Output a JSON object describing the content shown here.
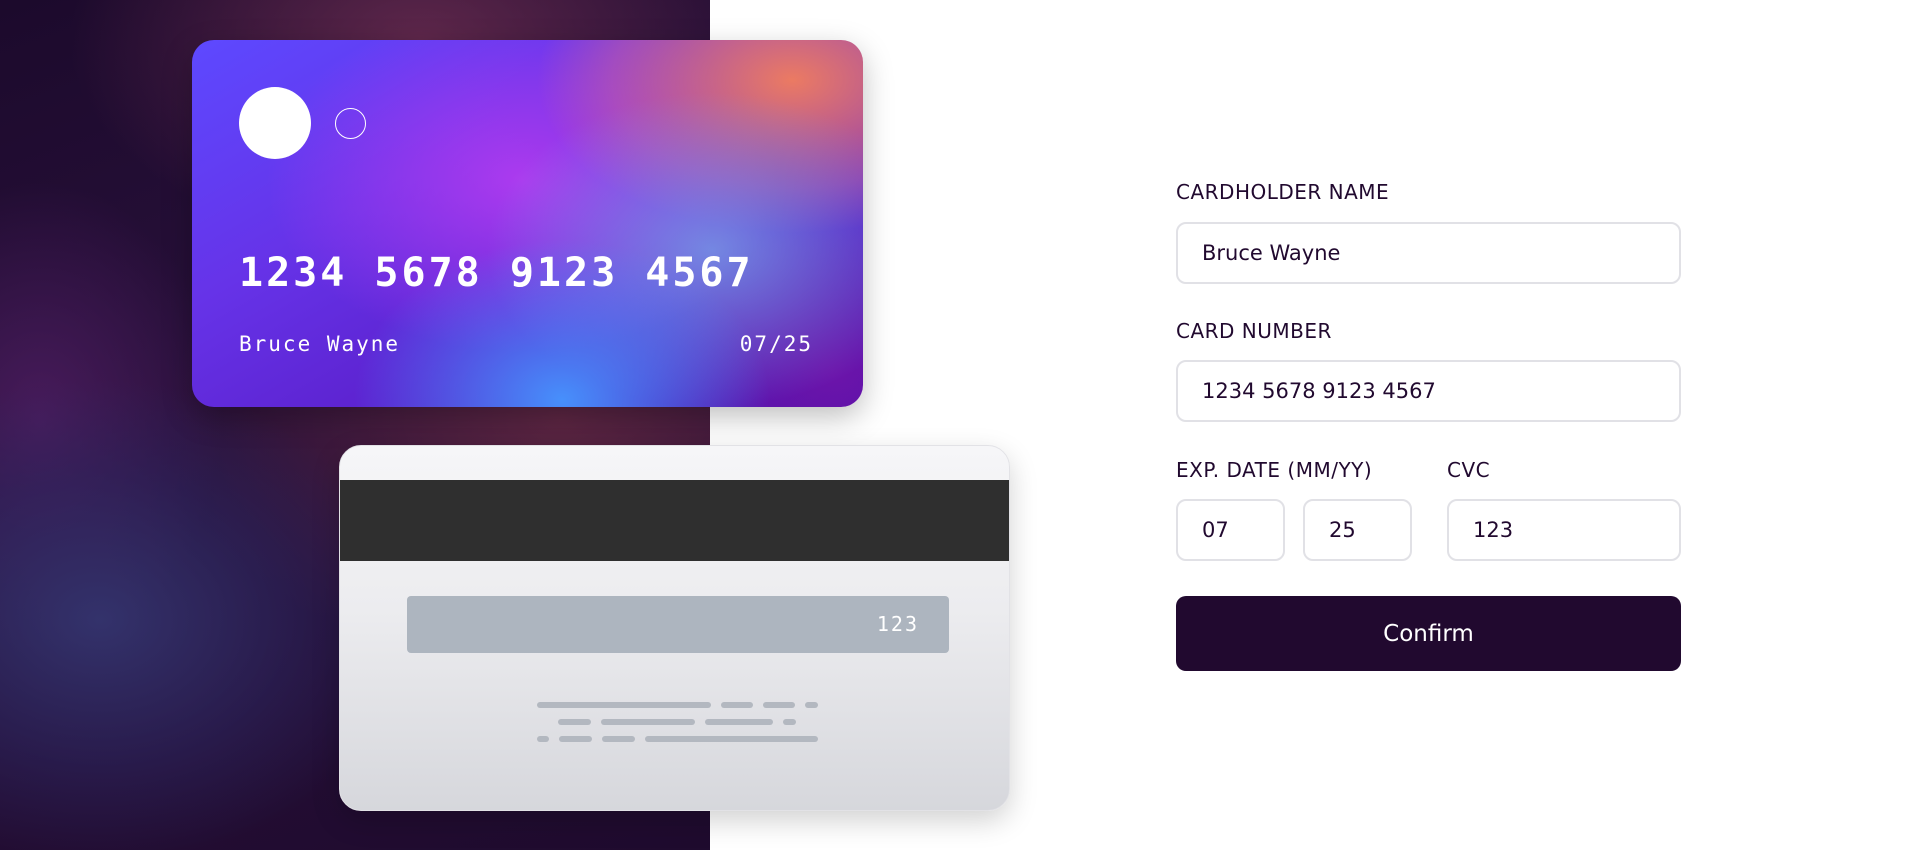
{
  "card_front": {
    "number": "1234 5678 9123 4567",
    "holder": "Bruce Wayne",
    "expiry": "07/25"
  },
  "card_back": {
    "cvc": "123"
  },
  "form": {
    "name_label": "CARDHOLDER NAME",
    "name_value": "Bruce Wayne",
    "number_label": "CARD NUMBER",
    "number_value": "1234 5678 9123 4567",
    "exp_label": "EXP. DATE (MM/YY)",
    "exp_month_value": "07",
    "exp_year_value": "25",
    "cvc_label": "CVC",
    "cvc_value": "123",
    "confirm_label": "Confirm"
  },
  "colors": {
    "ink": "#21092f",
    "input_border": "#e1e1e6",
    "stripe": "#2f2f2f",
    "signature_strip": "#adb5bf"
  }
}
